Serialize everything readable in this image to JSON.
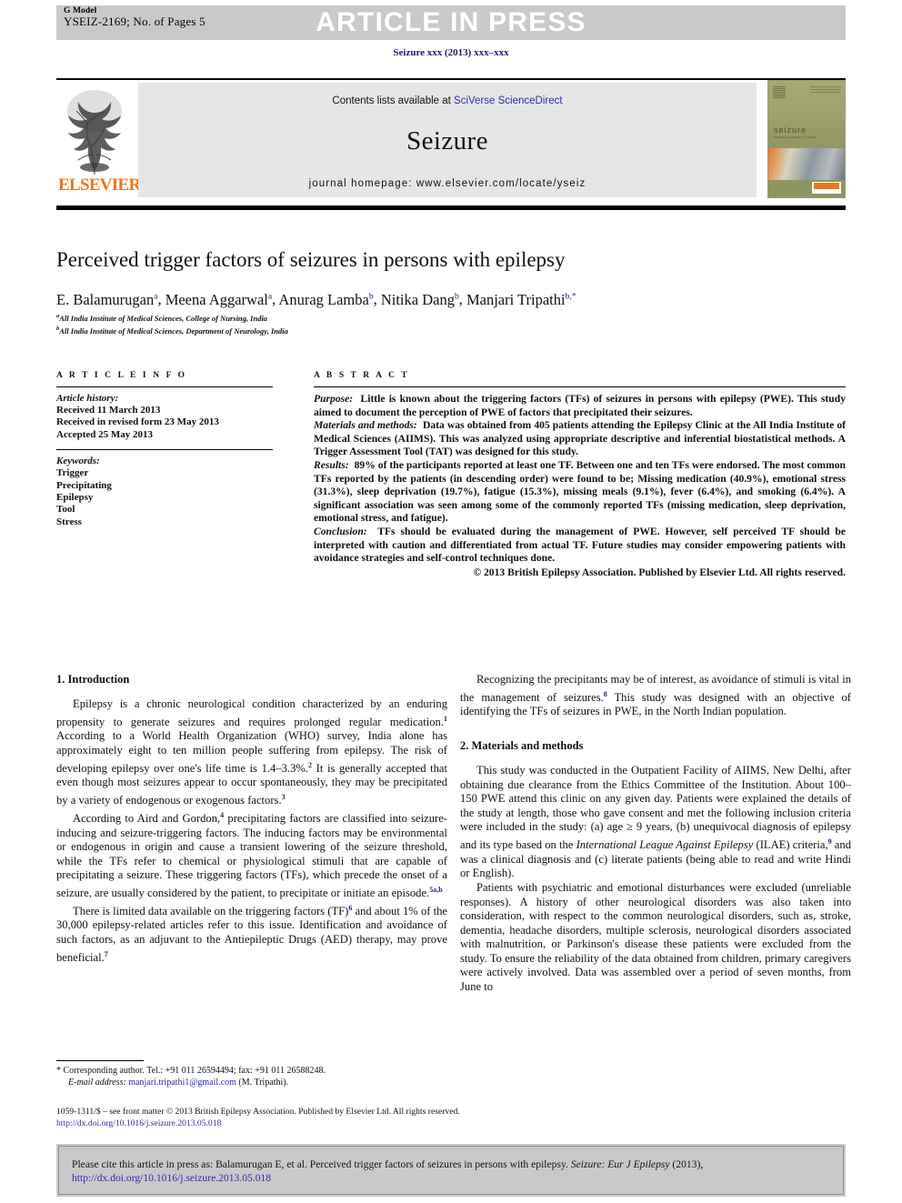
{
  "header": {
    "g_model": "G Model",
    "manuscript_id": "YSEIZ-2169; No. of Pages 5",
    "status_banner": "ARTICLE IN PRESS",
    "journal_reference": "Seizure xxx (2013) xxx–xxx",
    "banner_bg": "#c9c9c9",
    "banner_text_color": "#ffffff"
  },
  "masthead": {
    "publisher_name": "ELSEVIER",
    "publisher_color": "#E87722",
    "contents_prefix": "Contents lists available at ",
    "contents_link": "SciVerse ScienceDirect",
    "journal_title": "Seizure",
    "homepage_label": "journal homepage: www.elsevier.com/locate/yseiz",
    "cover_title": "seizure",
    "cover_subtitle": "European Journal of Epilepsy",
    "cover_publisher": "elsevier"
  },
  "article": {
    "title": "Perceived trigger factors of seizures in persons with epilepsy",
    "authors": [
      {
        "name": "E. Balamurugan",
        "sup": "a"
      },
      {
        "name": "Meena Aggarwal",
        "sup": "a"
      },
      {
        "name": "Anurag Lamba",
        "sup": "b"
      },
      {
        "name": "Nitika Dang",
        "sup": "b"
      },
      {
        "name": "Manjari Tripathi",
        "sup": "b,*"
      }
    ],
    "affiliations": [
      {
        "mark": "a",
        "text": "All India Institute of Medical Sciences, College of Nursing, India"
      },
      {
        "mark": "b",
        "text": "All India Institute of Medical Sciences, Department of Neurology, India"
      }
    ]
  },
  "article_info": {
    "heading": "A R T I C L E   I N F O",
    "history_label": "Article history:",
    "history": [
      "Received 11 March 2013",
      "Received in revised form 23 May 2013",
      "Accepted 25 May 2013"
    ],
    "keywords_label": "Keywords:",
    "keywords": [
      "Trigger",
      "Precipitating",
      "Epilepsy",
      "Tool",
      "Stress"
    ]
  },
  "abstract": {
    "heading": "A B S T R A C T",
    "sections": [
      {
        "label": "Purpose:",
        "text": "Little is known about the triggering factors (TFs) of seizures in persons with epilepsy (PWE). This study aimed to document the perception of PWE of factors that precipitated their seizures."
      },
      {
        "label": "Materials and methods:",
        "text": "Data was obtained from 405 patients attending the Epilepsy Clinic at the All India Institute of Medical Sciences (AIIMS). This was analyzed using appropriate descriptive and inferential biostatistical methods. A Trigger Assessment Tool (TAT) was designed for this study."
      },
      {
        "label": "Results:",
        "text": "89% of the participants reported at least one TF. Between one and ten TFs were endorsed. The most common TFs reported by the patients (in descending order) were found to be; Missing medication (40.9%), emotional stress (31.3%), sleep deprivation (19.7%), fatigue (15.3%), missing meals (9.1%), fever (6.4%), and smoking (6.4%). A significant association was seen among some of the commonly reported TFs (missing medication, sleep deprivation, emotional stress, and fatigue)."
      },
      {
        "label": "Conclusion:",
        "text": "TFs should be evaluated during the management of PWE. However, self perceived TF should be interpreted with caution and differentiated from actual TF. Future studies may consider empowering patients with avoidance strategies and self-control techniques done."
      }
    ],
    "copyright": "© 2013 British Epilepsy Association. Published by Elsevier Ltd. All rights reserved."
  },
  "body": {
    "left": {
      "section_heading": "1. Introduction",
      "paragraphs": [
        "Epilepsy is a chronic neurological condition characterized by an enduring propensity to generate seizures and requires prolonged regular medication.<sup>1</sup> According to a World Health Organization (WHO) survey, India alone has approximately eight to ten million people suffering from epilepsy. The risk of developing epilepsy over one's life time is 1.4–3.3%.<sup>2</sup> It is generally accepted that even though most seizures appear to occur spontaneously, they may be precipitated by a variety of endogenous or exogenous factors.<sup>3</sup>",
        "According to Aird and Gordon,<sup>4</sup> precipitating factors are classified into seizure-inducing and seizure-triggering factors. The inducing factors may be environmental or endogenous in origin and cause a transient lowering of the seizure threshold, while the TFs refer to chemical or physiological stimuli that are capable of precipitating a seizure. These triggering factors (TFs), which precede the onset of a seizure, are usually considered by the patient, to precipitate or initiate an episode.<sup>5a,b</sup>",
        "There is limited data available on the triggering factors (TF)<sup>6</sup> and about 1% of the 30,000 epilepsy-related articles refer to this issue. Identification and avoidance of such factors, as an adjuvant to the Antiepileptic Drugs (AED) therapy, may prove beneficial.<sup>7</sup>"
      ]
    },
    "right": {
      "intro_continuation": "Recognizing the precipitants may be of interest, as avoidance of stimuli is vital in the management of seizures.<sup>8</sup> This study was designed with an objective of identifying the TFs of seizures in PWE, in the North Indian population.",
      "section_heading": "2. Materials and methods",
      "paragraphs": [
        "This study was conducted in the Outpatient Facility of AIIMS, New Delhi, after obtaining due clearance from the Ethics Committee of the Institution. About 100–150 PWE attend this clinic on any given day. Patients were explained the details of the study at length, those who gave consent and met the following inclusion criteria were included in the study: (a) age ≥ 9 years, (b) unequivocal diagnosis of epilepsy and its type based on the <span class=\"ital\">International League Against Epilepsy</span> (ILAE) criteria,<sup>9</sup> and was a clinical diagnosis and (c) literate patients (being able to read and write Hindi or English).",
        "Patients with psychiatric and emotional disturbances were excluded (unreliable responses). A history of other neurological disorders was also taken into consideration, with respect to the common neurological disorders, such as, stroke, dementia, headache disorders, multiple sclerosis, neurological disorders associated with malnutrition, or Parkinson's disease these patients were excluded from the study. To ensure the reliability of the data obtained from children, primary caregivers were actively involved. Data was assembled over a period of seven months, from June to"
      ]
    }
  },
  "footnote": {
    "marker": "*",
    "corresponding": "Corresponding author. Tel.: +91 011 26594494; fax: +91 011 26588248.",
    "email_label": "E-mail address:",
    "email": "manjari.tripathi1@gmail.com",
    "email_owner": "(M. Tripathi)."
  },
  "frontmatter": {
    "line": "1059-1311/$ – see front matter © 2013 British Epilepsy Association. Published by Elsevier Ltd. All rights reserved.",
    "doi": "http://dx.doi.org/10.1016/j.seizure.2013.05.018"
  },
  "cite_box": {
    "prefix": "Please cite this article in press as: Balamurugan E, et al. Perceived trigger factors of seizures in persons with epilepsy. ",
    "journal_italic": "Seizure: Eur J Epilepsy",
    "year": " (2013), ",
    "doi": "http://dx.doi.org/10.1016/j.seizure.2013.05.018",
    "bg": "#c9c9c9"
  }
}
